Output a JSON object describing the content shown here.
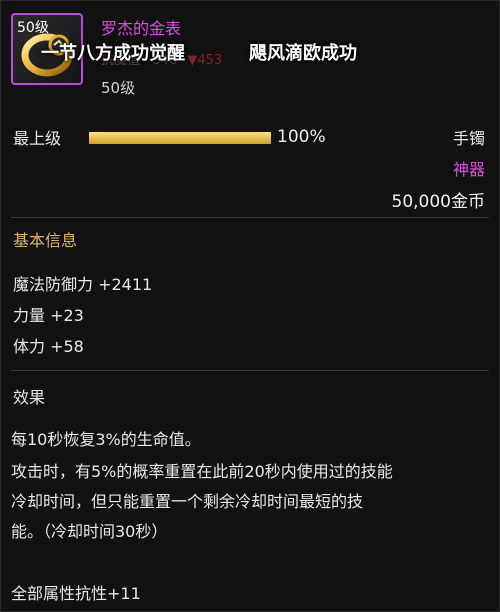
{
  "item": {
    "level_badge": "50级",
    "name": "罗杰的金表",
    "sub_label": "抗魔值 · 346",
    "sub_delta": "▼453",
    "level_text": "50级",
    "overlay_left": "一节八方成功觉醒",
    "overlay_right": "飓风滴欧成功"
  },
  "status": {
    "grade_label": "最上级",
    "progress_fraction": 1.0,
    "progress_text": "100%",
    "slot": "手镯",
    "rarity": "神器",
    "price": "50,000金币"
  },
  "basic": {
    "title": "基本信息",
    "stats": [
      "魔法防御力 +2411",
      "力量 +23",
      "体力 +58"
    ]
  },
  "effect": {
    "title": "效果",
    "line1": "每10秒恢复3%的生命值。",
    "line2": "攻击时，有5%的概率重置在此前20秒内使用过的技能",
    "line3": "冷却时间，但只能重置一个剩余冷却时间最短的技",
    "line4": "能。（冷却时间30秒）",
    "line5": "全部属性抗性+11"
  },
  "colors": {
    "rarity": "#d34fd6",
    "bar_fill": "#d1a219",
    "section_title": "#d6b86b"
  },
  "icons": {
    "item_icon": "gold-watch-bracelet-icon"
  }
}
